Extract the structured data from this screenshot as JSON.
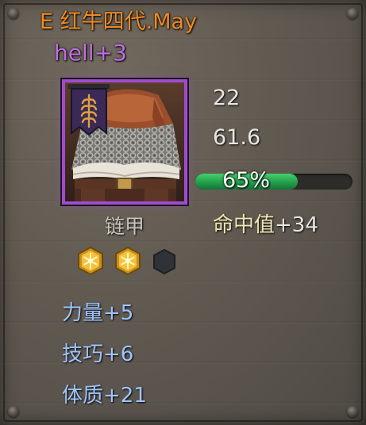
{
  "item": {
    "title": "E 红牛四代.May",
    "enhance": "hell+3",
    "name": "链甲",
    "icon": "chain-mail-armor-with-banner-icon",
    "rarity_color": "#a04bcf"
  },
  "stats": {
    "value_1": "22",
    "value_2": "61.6",
    "durability": {
      "label": "65%",
      "fraction": 0.65
    },
    "hit": {
      "label": "命中值",
      "value": "+34"
    }
  },
  "sockets": {
    "filled": 2,
    "total": 3,
    "filled_icon": "gold-hexagon-gem-icon",
    "empty_icon": "empty-hexagon-socket-icon"
  },
  "attributes": [
    {
      "text": "力量+5"
    },
    {
      "text": "技巧+6"
    },
    {
      "text": "体质+21"
    }
  ],
  "colors": {
    "title": "#f08a22",
    "enhance": "#c06fe3",
    "attribute": "#9fc4ff",
    "bar": "#22a04b"
  }
}
